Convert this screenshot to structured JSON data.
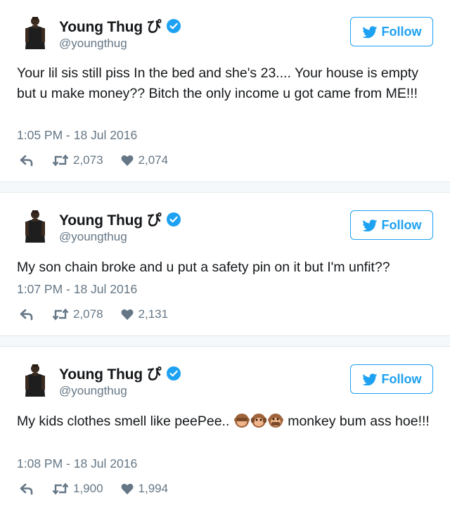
{
  "colors": {
    "accent": "#1da1f2",
    "muted": "#657786",
    "text": "#14171a",
    "separator": "#f5f8fa"
  },
  "tweets": [
    {
      "display_name": "Young Thug ぴ",
      "handle": "@youngthug",
      "follow_label": "Follow",
      "text": "Your lil sis still piss In the bed and she's 23.... Your house is empty but u make money?? Bitch the only income u got came from ME!!!",
      "timestamp": "1:05 PM - 18 Jul 2016",
      "retweets": "2,073",
      "likes": "2,074"
    },
    {
      "display_name": "Young Thug ぴ",
      "handle": "@youngthug",
      "follow_label": "Follow",
      "text": "My son chain broke and u put a safety pin on it but I'm unfit??",
      "timestamp": "1:07 PM - 18 Jul 2016",
      "retweets": "2,078",
      "likes": "2,131"
    },
    {
      "display_name": "Young Thug ぴ",
      "handle": "@youngthug",
      "follow_label": "Follow",
      "text_before_emoji": "My kids clothes smell like peePee..",
      "emoji": [
        "see-no-evil-monkey",
        "hear-no-evil-monkey",
        "speak-no-evil-monkey"
      ],
      "text_after_emoji": "monkey bum ass hoe!!!",
      "timestamp": "1:08 PM - 18 Jul 2016",
      "retweets": "1,900",
      "likes": "1,994"
    }
  ]
}
